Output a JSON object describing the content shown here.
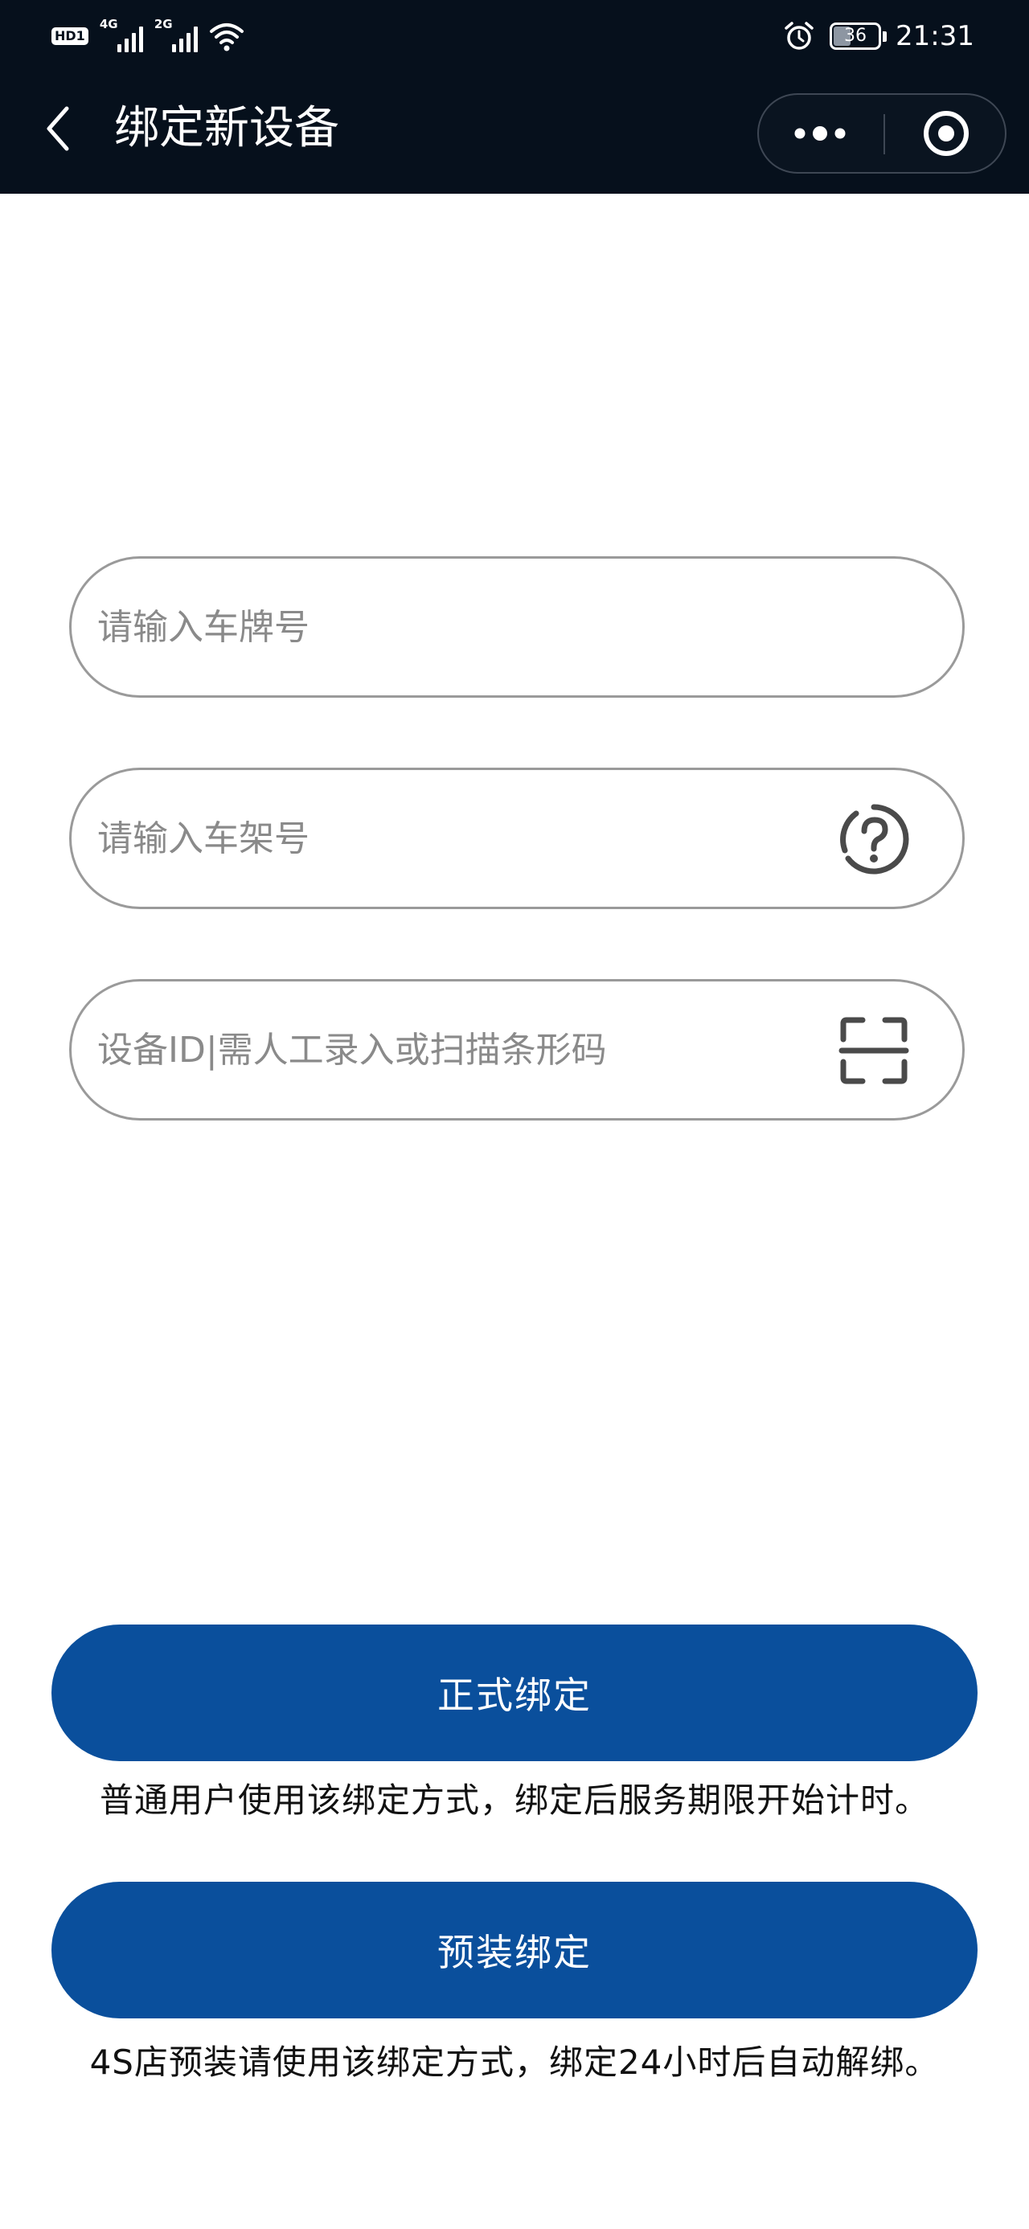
{
  "status_bar": {
    "hd_badge": "HD1",
    "network_1": "4G",
    "network_2": "2G",
    "battery": "36",
    "time": "21:31"
  },
  "header": {
    "title": "绑定新设备",
    "background_color": "#06101c"
  },
  "form": {
    "plate": {
      "placeholder": "请输入车牌号",
      "value": ""
    },
    "vin": {
      "placeholder": "请输入车架号",
      "value": ""
    },
    "device_id": {
      "placeholder": "设备ID|需人工录入或扫描条形码",
      "value": ""
    }
  },
  "actions": {
    "formal": {
      "label": "正式绑定",
      "hint": "普通用户使用该绑定方式，绑定后服务期限开始计时。"
    },
    "preinstall": {
      "label": "预装绑定",
      "hint": "4S店预装请使用该绑定方式，绑定24小时后自动解绑。"
    },
    "button_color": "#0a4f9c"
  },
  "icons": {
    "back": "chevron-left-icon",
    "more": "more-dots-icon",
    "close": "target-circle-icon",
    "vin_help": "question-circle-icon",
    "scan": "scan-frame-icon",
    "alarm": "alarm-clock-icon",
    "wifi": "wifi-icon"
  }
}
